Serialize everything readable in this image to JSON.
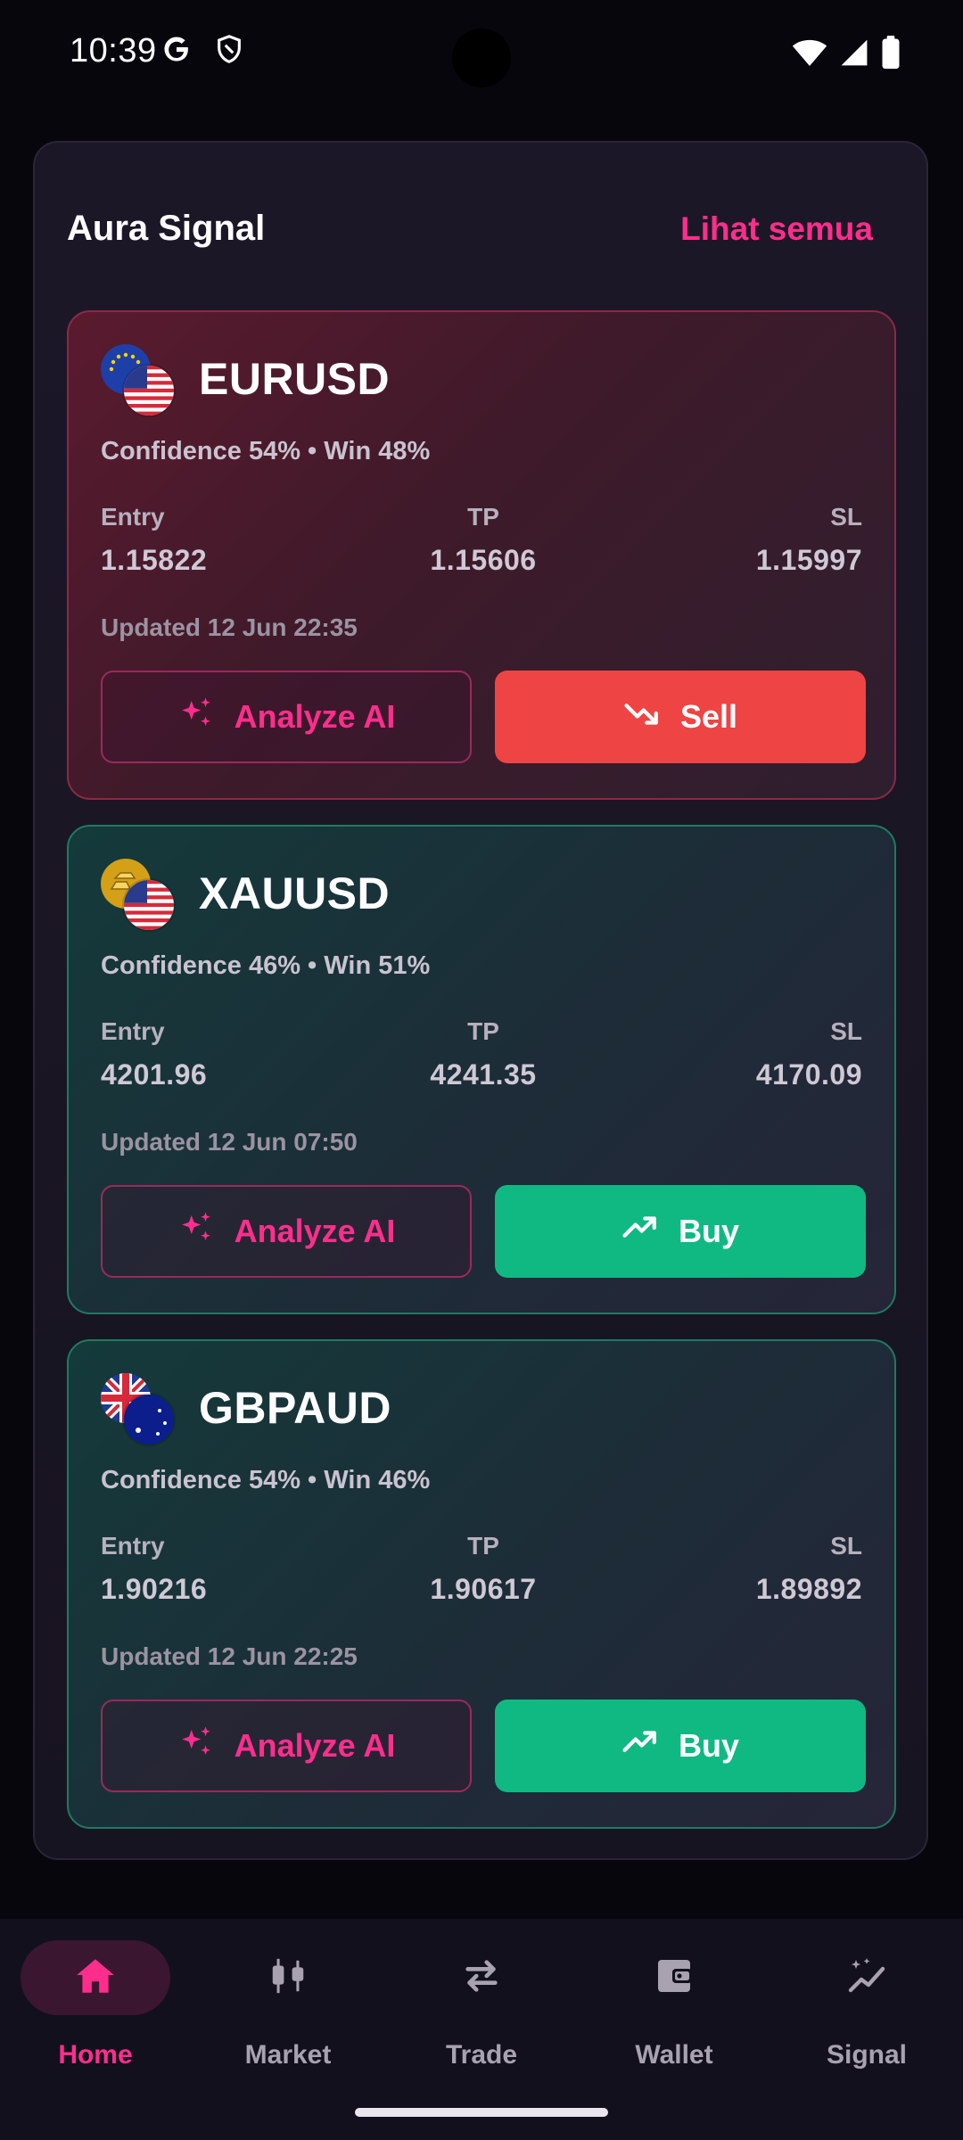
{
  "status_bar": {
    "time": "10:39",
    "icons": [
      "google-icon",
      "shield-icon",
      "wifi-icon",
      "signal-icon",
      "battery-icon"
    ]
  },
  "section": {
    "title": "Aura Signal",
    "see_all": "Lihat semua"
  },
  "labels": {
    "entry": "Entry",
    "tp": "TP",
    "sl": "SL",
    "analyze": "Analyze AI"
  },
  "signals": [
    {
      "pair": "EURUSD",
      "stats": "Confidence 54% • Win 48%",
      "entry": "1.15822",
      "tp": "1.15606",
      "sl": "1.15997",
      "updated": "Updated 12 Jun 22:35",
      "action": "Sell",
      "flags": [
        "eu-flag-icon",
        "us-flag-icon"
      ]
    },
    {
      "pair": "XAUUSD",
      "stats": "Confidence 46% • Win 51%",
      "entry": "4201.96",
      "tp": "4241.35",
      "sl": "4170.09",
      "updated": "Updated 12 Jun 07:50",
      "action": "Buy",
      "flags": [
        "gold-icon",
        "us-flag-icon"
      ]
    },
    {
      "pair": "GBPAUD",
      "stats": "Confidence 54% • Win 46%",
      "entry": "1.90216",
      "tp": "1.90617",
      "sl": "1.89892",
      "updated": "Updated 12 Jun 22:25",
      "action": "Buy",
      "flags": [
        "uk-flag-icon",
        "au-flag-icon"
      ]
    }
  ],
  "nav": {
    "items": [
      {
        "label": "Home",
        "icon": "home-icon",
        "active": true
      },
      {
        "label": "Market",
        "icon": "candlestick-icon",
        "active": false
      },
      {
        "label": "Trade",
        "icon": "swap-icon",
        "active": false
      },
      {
        "label": "Wallet",
        "icon": "wallet-icon",
        "active": false
      },
      {
        "label": "Signal",
        "icon": "signal-chart-icon",
        "active": false
      }
    ]
  },
  "colors": {
    "accent": "#ff2e8c",
    "sell": "#ef4444",
    "buy": "#10b981",
    "background": "#06060c"
  }
}
